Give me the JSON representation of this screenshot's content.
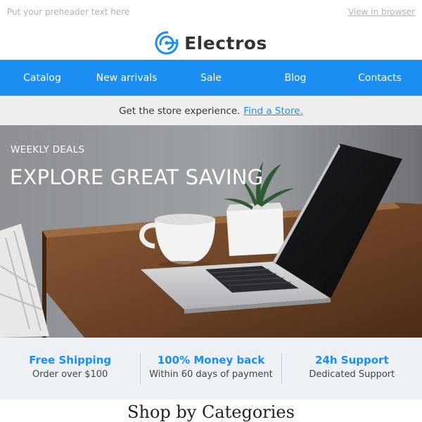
{
  "preheader": {
    "text": "Put your preheader text here",
    "view_in_browser": "View in browser"
  },
  "brand": {
    "name": "Electros",
    "logo_icon": "circuit-circle-icon",
    "accent_color": "#1b8ef2"
  },
  "nav": {
    "items": [
      {
        "label": "Catalog"
      },
      {
        "label": "New arrivals"
      },
      {
        "label": "Sale"
      },
      {
        "label": "Blog"
      },
      {
        "label": "Contacts"
      }
    ]
  },
  "store_bar": {
    "text": "Get the store experience.",
    "link": "Find a Store."
  },
  "hero": {
    "kicker": "WEEKLY DEALS",
    "headline": "EXPLORE GREAT SAVING"
  },
  "features": [
    {
      "title": "Free Shipping",
      "subtitle": "Order over $100"
    },
    {
      "title": "100% Money back",
      "subtitle": "Within 60 days of payment"
    },
    {
      "title": "24h Support",
      "subtitle": "Dedicated Support"
    }
  ],
  "section": {
    "heading": "Shop by Categories"
  }
}
